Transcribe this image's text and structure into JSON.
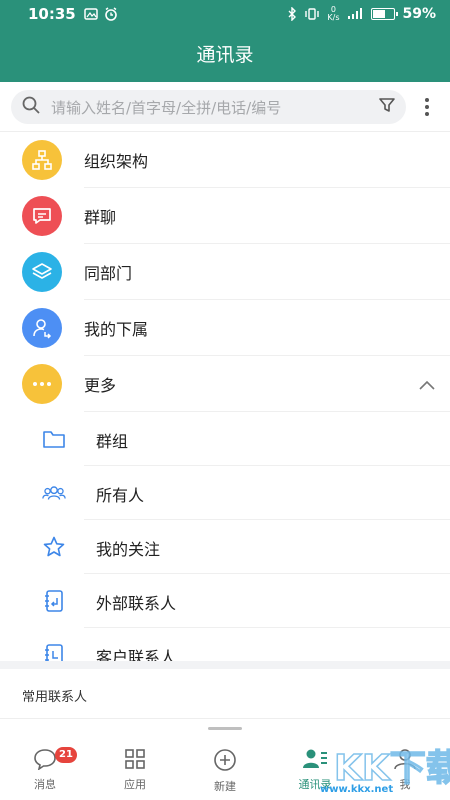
{
  "status": {
    "time": "10:35",
    "netspeed_top": "0",
    "netspeed_bottom": "K/s",
    "battery": "59%",
    "battery_level": 0.59
  },
  "header": {
    "title": "通讯录"
  },
  "search": {
    "placeholder": "请输入姓名/首字母/全拼/电话/编号"
  },
  "rows": [
    {
      "label": "组织架构",
      "icon": "org-chart-icon",
      "color": "#f7c23a"
    },
    {
      "label": "群聊",
      "icon": "chat-icon",
      "color": "#ee4f55"
    },
    {
      "label": "同部门",
      "icon": "layers-icon",
      "color": "#2bb2e6"
    },
    {
      "label": "我的下属",
      "icon": "subordinate-icon",
      "color": "#4d8ff4"
    },
    {
      "label": "更多",
      "icon": "more-dots-icon",
      "color": "#f7c23a"
    }
  ],
  "sub_items": [
    {
      "label": "群组",
      "icon": "folder-icon"
    },
    {
      "label": "所有人",
      "icon": "people-icon"
    },
    {
      "label": "我的关注",
      "icon": "star-icon"
    },
    {
      "label": "外部联系人",
      "icon": "external-contact-icon"
    },
    {
      "label": "客户联系人",
      "icon": "customer-contact-icon"
    }
  ],
  "section": {
    "title": "常用联系人"
  },
  "tabs": [
    {
      "label": "消息",
      "icon": "message-icon",
      "badge": "21"
    },
    {
      "label": "应用",
      "icon": "apps-icon"
    },
    {
      "label": "新建",
      "icon": "add-circle-icon"
    },
    {
      "label": "通讯录",
      "icon": "contacts-icon",
      "active": true
    },
    {
      "label": "我",
      "icon": "profile-icon"
    }
  ],
  "accent_color": "#2a917a",
  "watermark": {
    "text": "KK下载",
    "url_text": "www.kkx.net"
  }
}
